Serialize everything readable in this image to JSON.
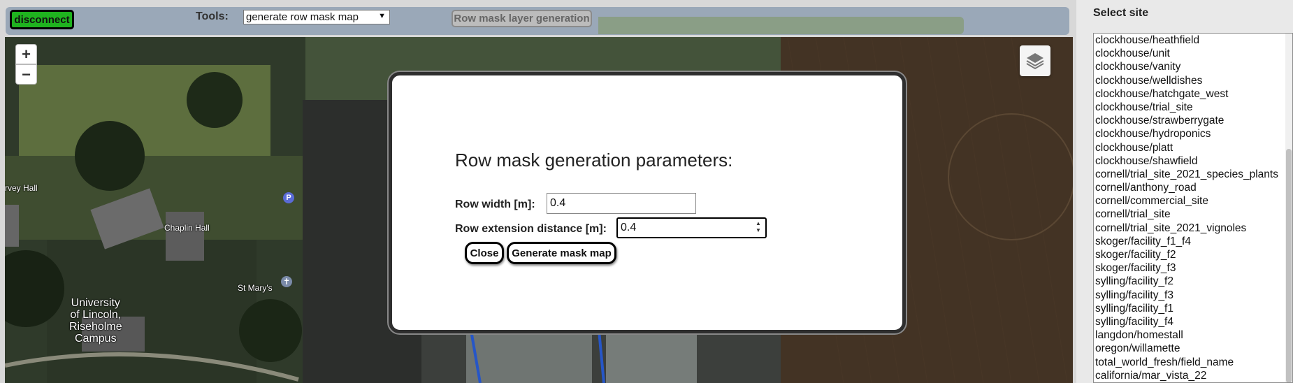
{
  "toolbar": {
    "disconnect_label": "disconnect",
    "tools_label": "Tools:",
    "tools_selected": "generate row mask map",
    "generate_layer_label": "Row mask layer generation"
  },
  "map": {
    "zoom_in": "+",
    "zoom_out": "−",
    "labels": {
      "harvey_hall": "rvey Hall",
      "chaplin_hall": "Chaplin Hall",
      "st_marys": "St Mary's",
      "parking": "P",
      "campus_line1": "University",
      "campus_line2": "of Lincoln,",
      "campus_line3": "Riseholme",
      "campus_line4": "Campus"
    }
  },
  "modal": {
    "title": "Row mask generation parameters:",
    "row_width_label": "Row width [m]:",
    "row_width_value": "0.4",
    "row_extension_label": "Row extension distance [m]:",
    "row_extension_value": "0.4",
    "close_label": "Close",
    "generate_label": "Generate mask map"
  },
  "sidebar": {
    "title": "Select site",
    "sites": [
      "clockhouse/heathfield",
      "clockhouse/unit",
      "clockhouse/vanity",
      "clockhouse/welldishes",
      "clockhouse/hatchgate_west",
      "clockhouse/trial_site",
      "clockhouse/strawberrygate",
      "clockhouse/hydroponics",
      "clockhouse/platt",
      "clockhouse/shawfield",
      "cornell/trial_site_2021_species_plants",
      "cornell/anthony_road",
      "cornell/commercial_site",
      "cornell/trial_site",
      "cornell/trial_site_2021_vignoles",
      "skoger/facility_f1_f4",
      "skoger/facility_f2",
      "skoger/facility_f3",
      "sylling/facility_f2",
      "sylling/facility_f3",
      "sylling/facility_f1",
      "sylling/facility_f4",
      "langdon/homestall",
      "oregon/willamette",
      "total_world_fresh/field_name",
      "california/mar_vista_22"
    ]
  },
  "colors": {
    "disconnect_bg": "#1fb31f",
    "toolbar_bg": "#9aa8b8",
    "modal_border": "#2e2e2e"
  },
  "icons": [
    "layers-icon",
    "chevron-down-icon",
    "spinner-arrows-icon",
    "parking-icon",
    "church-icon"
  ]
}
